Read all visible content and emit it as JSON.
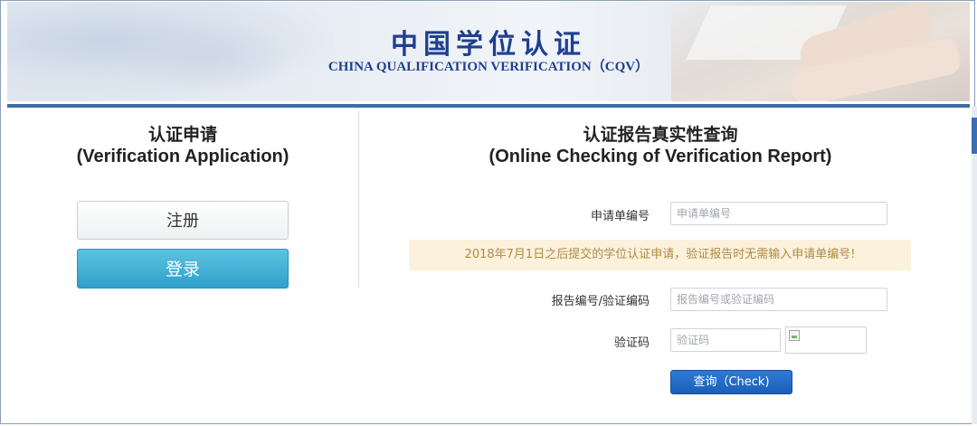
{
  "header": {
    "title": "中国学位认证",
    "subtitle": "CHINA QUALIFICATION VERIFICATION（CQV）"
  },
  "left_panel": {
    "title_cn": "认证申请",
    "title_en": "(Verification Application)",
    "register_label": "注册",
    "login_label": "登录"
  },
  "right_panel": {
    "title_cn": "认证报告真实性查询",
    "title_en": "(Online Checking of Verification Report)",
    "application_no_label": "申请单编号",
    "application_no_placeholder": "申请单编号",
    "notice": "2018年7月1日之后提交的学位认证申请，验证报告时无需输入申请单编号!",
    "report_no_label": "报告编号/验证编码",
    "report_no_placeholder": "报告编号或验证编码",
    "captcha_label": "验证码",
    "captcha_placeholder": "验证码",
    "check_label": "查询（Check)"
  },
  "colors": {
    "brand_blue": "#1f3f8f",
    "login_button": "#2f9fcb",
    "check_button": "#1a5fb8",
    "notice_bg": "#fbf1dd"
  }
}
